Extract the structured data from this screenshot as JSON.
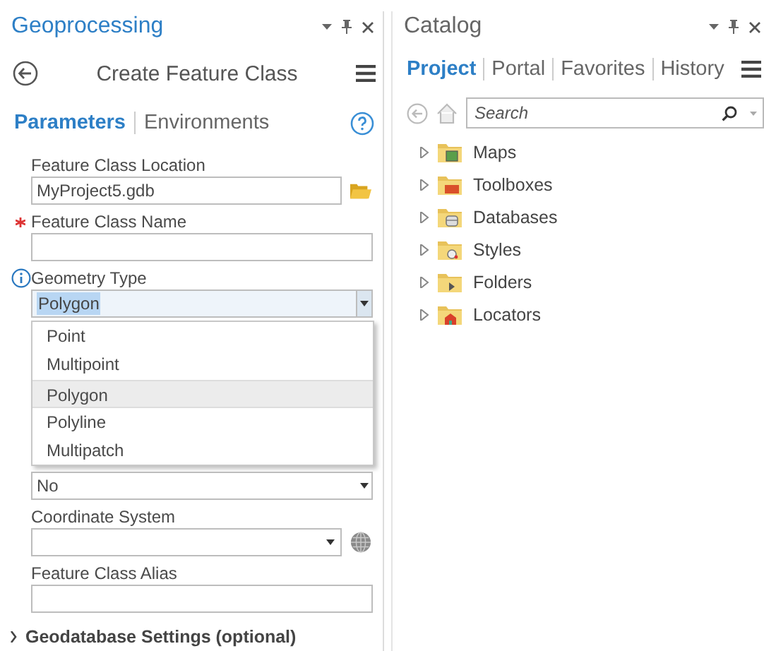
{
  "geoprocessing": {
    "title": "Geoprocessing",
    "tool_title": "Create Feature Class",
    "tabs": [
      {
        "label": "Parameters",
        "selected": true
      },
      {
        "label": "Environments",
        "selected": false
      }
    ],
    "parameters": [
      {
        "kind": "path",
        "label": "Feature Class Location",
        "value": "MyProject5.gdb",
        "required": false,
        "info": false
      },
      {
        "kind": "text",
        "label": "Feature Class Name",
        "required": true,
        "info": false
      },
      {
        "kind": "select",
        "label": "Geometry Type",
        "value": "Polygon",
        "required": false,
        "info": true,
        "expanded": true,
        "options": [
          {
            "label": "Point",
            "selected": false
          },
          {
            "label": "Multipoint",
            "selected": false
          },
          {
            "label": "Polygon",
            "selected": true
          },
          {
            "label": "Polyline",
            "selected": false
          },
          {
            "label": "Multipatch",
            "selected": false
          }
        ]
      },
      {
        "kind": "select",
        "value": "No",
        "required": false,
        "info": false,
        "expanded": false
      },
      {
        "kind": "coordinate",
        "label": "Coordinate System",
        "required": false,
        "info": false
      },
      {
        "kind": "text",
        "label": "Feature Class Alias",
        "required": false,
        "info": false
      }
    ],
    "section": {
      "label": "Geodatabase Settings (optional)",
      "expanded": false
    }
  },
  "catalog": {
    "title": "Catalog",
    "tabs": [
      {
        "label": "Project",
        "selected": true
      },
      {
        "label": "Portal",
        "selected": false
      },
      {
        "label": "Favorites",
        "selected": false
      },
      {
        "label": "History",
        "selected": false
      }
    ],
    "search": {
      "placeholder": "Search"
    },
    "items": [
      {
        "kind": "maps",
        "label": "Maps",
        "expanded": false
      },
      {
        "kind": "toolboxes",
        "label": "Toolboxes",
        "expanded": false
      },
      {
        "kind": "databases",
        "label": "Databases",
        "expanded": false
      },
      {
        "kind": "styles",
        "label": "Styles",
        "expanded": false
      },
      {
        "kind": "folders",
        "label": "Folders",
        "expanded": false
      },
      {
        "kind": "locators",
        "label": "Locators",
        "expanded": false
      }
    ]
  }
}
